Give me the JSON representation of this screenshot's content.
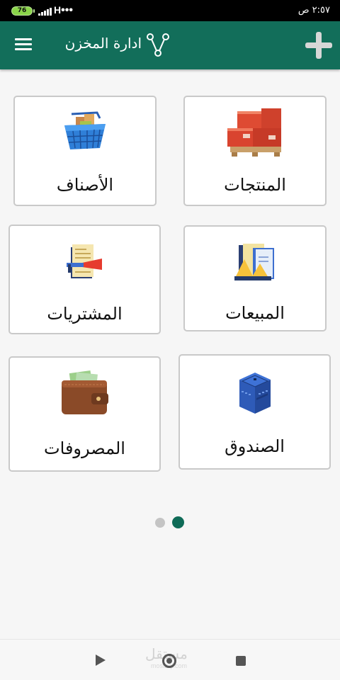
{
  "status_bar": {
    "battery": "76",
    "network": "H",
    "time": "٢:٥٧ ص"
  },
  "app_bar": {
    "title": "ادارة المخزن",
    "menu_icon": "hamburger-menu-icon",
    "logo_icon": "branch-nodes-icon",
    "add_icon": "plus-icon",
    "color": "#126e5a"
  },
  "grid": {
    "products": {
      "label": "المنتجات",
      "icon": "pallet-boxes-icon"
    },
    "categories": {
      "label": "الأصناف",
      "icon": "shopping-basket-icon"
    },
    "sales": {
      "label": "المبيعات",
      "icon": "sales-documents-icon"
    },
    "purchases": {
      "label": "المشتريات",
      "icon": "purchase-invoice-icon"
    },
    "cashbox": {
      "label": "الصندوق",
      "icon": "cash-box-icon"
    },
    "expenses": {
      "label": "المصروفات",
      "icon": "wallet-icon"
    }
  },
  "pager": {
    "pages": 2,
    "active_page": 2,
    "active_color": "#0f6b57",
    "inactive_color": "#c4c4c4"
  },
  "nav_bar": {
    "back_icon": "back-triangle-icon",
    "home_icon": "home-circle-icon",
    "recent_icon": "recent-square-icon",
    "watermark": "مستقل",
    "watermark_sub": "mostaql.com"
  }
}
